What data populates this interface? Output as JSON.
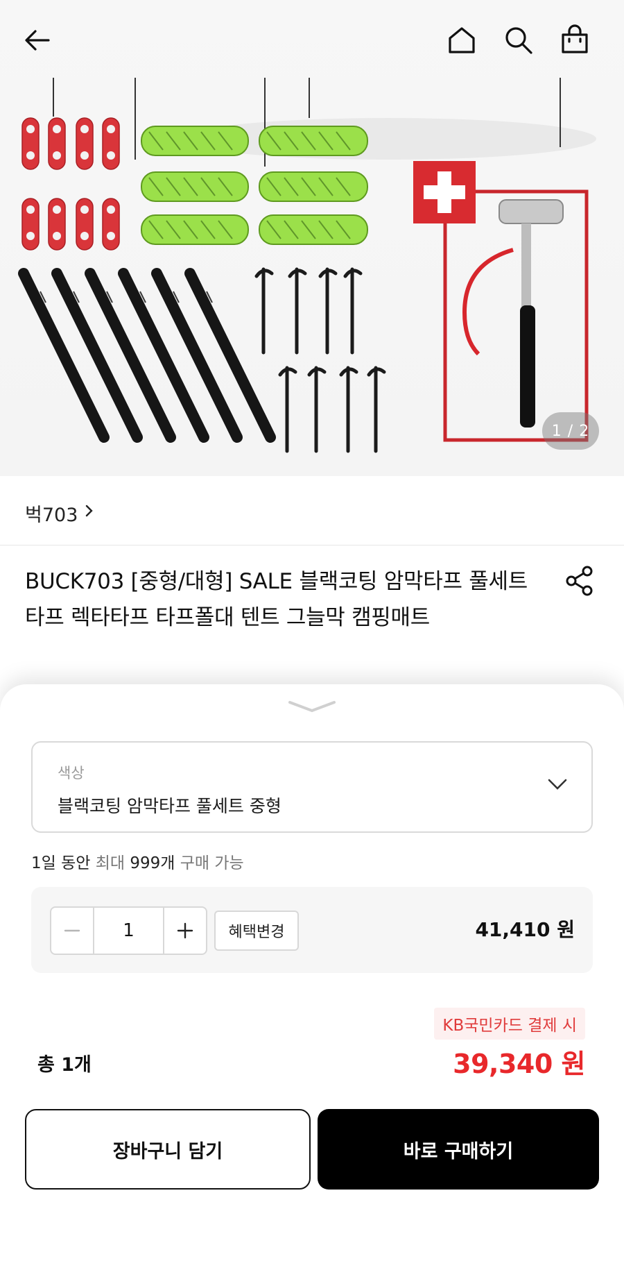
{
  "header": {
    "back_icon": "arrow-left-icon",
    "home_icon": "home-icon",
    "search_icon": "search-icon",
    "cart_icon": "shopping-bag-icon"
  },
  "gallery": {
    "indicator": "1 / 2"
  },
  "brand": {
    "name": "벅703"
  },
  "product": {
    "title": "BUCK703 [중형/대형] SALE 블랙코팅 암막타프 풀세트 타프 렉타타프 타프폴대 텐트 그늘막 캠핑매트"
  },
  "option": {
    "label": "색상",
    "value": "블랙코팅 암막타프 풀세트 중형"
  },
  "limit": {
    "prefix": "1일 동안 ",
    "max_word": "최대",
    "count": " 999개 ",
    "suffix": "구매 가능"
  },
  "quantity": {
    "value": "1",
    "benefit_label": "혜택변경",
    "price": "41,410 원"
  },
  "summary": {
    "card_note": "KB국민카드 결제 시",
    "total_label": "총 1개",
    "total_price": "39,340 원"
  },
  "actions": {
    "cart_label": "장바구니 담기",
    "buy_label": "바로 구매하기"
  },
  "colors": {
    "accent_red": "#e8282b",
    "buy_button": "#000000"
  }
}
